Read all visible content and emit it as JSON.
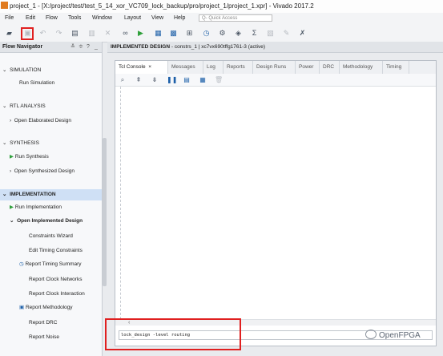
{
  "window": {
    "title": "project_1 - [X:/project/test/test_5_14_xor_VC709_lock_backup/pro/project_1/project_1.xpr] - Vivado 2017.2"
  },
  "menu": [
    "File",
    "Edit",
    "Flow",
    "Tools",
    "Window",
    "Layout",
    "View",
    "Help"
  ],
  "quick_access": {
    "placeholder": "Q- Quick Access"
  },
  "toolbar_icons": [
    "open-icon",
    "save-icon",
    "undo-icon",
    "redo-icon",
    "copy-icon",
    "paste-icon",
    "delete-icon",
    "binoculars-icon",
    "run-icon",
    "implementation-icon",
    "bitstream-icon",
    "program-icon",
    "timer-icon",
    "settings-icon",
    "report-icon",
    "sigma-icon",
    "compare-icon",
    "pencil-icon",
    "cross-icon"
  ],
  "flow_navigator": {
    "title": "Flow Navigator",
    "controls": [
      "≚",
      "≑",
      "?",
      "_"
    ],
    "simulation": {
      "label": "SIMULATION",
      "items": [
        "Run Simulation"
      ]
    },
    "rtl": {
      "label": "RTL ANALYSIS",
      "items": [
        "Open Elaborated Design"
      ]
    },
    "synthesis": {
      "label": "SYNTHESIS",
      "items": [
        "Run Synthesis",
        "Open Synthesized Design"
      ]
    },
    "implementation": {
      "label": "IMPLEMENTATION",
      "run": "Run Implementation",
      "open": "Open Implemented Design",
      "subitems": [
        "Constraints Wizard",
        "Edit Timing Constraints",
        "Report Timing Summary",
        "Report Clock Networks",
        "Report Clock Interaction",
        "Report Methodology",
        "Report DRC",
        "Report Noise"
      ]
    }
  },
  "main_header": {
    "title": "IMPLEMENTED DESIGN",
    "detail": " - constrs_1 | xc7vx690tffg1761-3  (active)"
  },
  "console": {
    "tabs": [
      "Tcl Console",
      "Messages",
      "Log",
      "Reports",
      "Design Runs",
      "Power",
      "DRC",
      "Methodology",
      "Timing"
    ],
    "active_tab_close": "×",
    "scroll_left": "‹",
    "command": "lock_design -level routing"
  },
  "watermark": "OpenFPGA",
  "colors": {
    "highlight": "#e02020",
    "selection": "#cfe0f5",
    "accent": "#1c5fa8"
  }
}
